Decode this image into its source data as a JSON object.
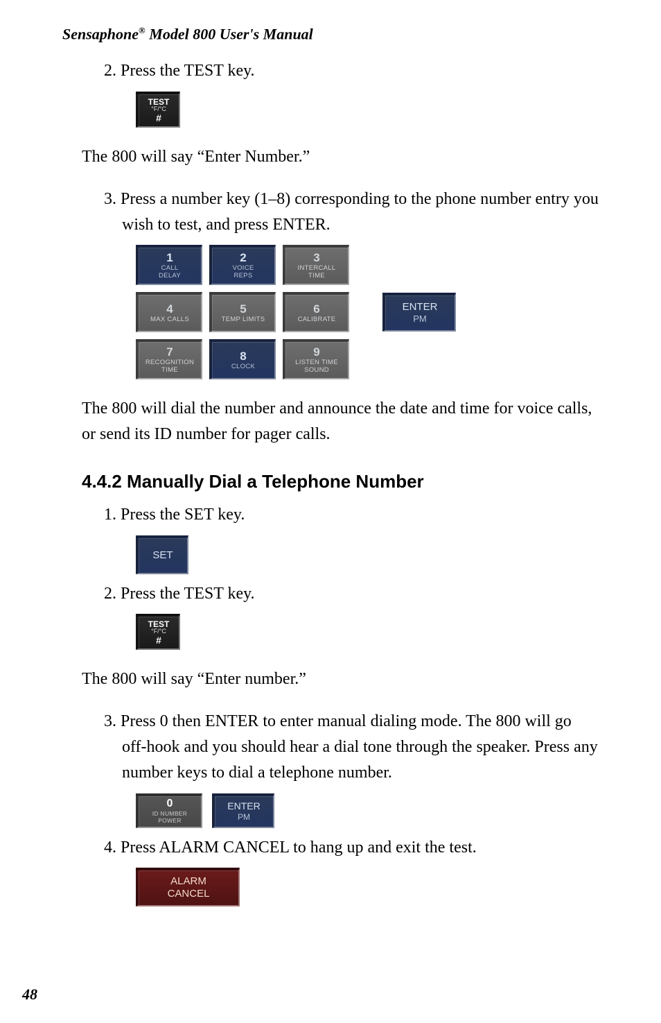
{
  "header": {
    "brand": "Sensaphone",
    "reg": "®",
    "rest": " Model 800 User's Manual"
  },
  "sec1": {
    "step2": "2. Press the TEST key.",
    "test_key": {
      "l1": "TEST",
      "l2": "°F/°C",
      "l3": "#"
    },
    "body1": "The 800 will say “Enter Number.”",
    "step3": "3. Press a number key (1–8) corresponding to the phone number entry you wish to test, and press ENTER.",
    "keypad": [
      {
        "num": "1",
        "sub1": "CALL",
        "sub2": "DELAY",
        "cls": "blue"
      },
      {
        "num": "2",
        "sub1": "VOICE",
        "sub2": "REPS",
        "cls": "blue"
      },
      {
        "num": "3",
        "sub1": "INTERCALL",
        "sub2": "TIME",
        "cls": "gray"
      },
      {
        "num": "4",
        "sub1": "MAX CALLS",
        "sub2": "",
        "cls": "gray"
      },
      {
        "num": "5",
        "sub1": "TEMP LIMITS",
        "sub2": "",
        "cls": "gray"
      },
      {
        "num": "6",
        "sub1": "CALIBRATE",
        "sub2": "",
        "cls": "gray"
      },
      {
        "num": "7",
        "sub1": "RECOGNITION",
        "sub2": "TIME",
        "cls": "gray"
      },
      {
        "num": "8",
        "sub1": "CLOCK",
        "sub2": "",
        "cls": "blue"
      },
      {
        "num": "9",
        "sub1": "LISTEN TIME",
        "sub2": "SOUND",
        "cls": "gray"
      }
    ],
    "enter": {
      "top": "ENTER",
      "bot": "PM"
    },
    "body2": "The 800 will dial the number and announce the date and time for voice calls, or send its ID number for pager calls."
  },
  "sec2": {
    "heading": "4.4.2  Manually Dial a Telephone Number",
    "step1": "1. Press the SET key.",
    "set_key": "SET",
    "step2": "2. Press the TEST key.",
    "test_key": {
      "l1": "TEST",
      "l2": "°F/°C",
      "l3": "#"
    },
    "body1": "The 800 will say “Enter number.”",
    "step3": "3. Press 0 then ENTER to enter manual dialing mode. The 800 will go off-hook and you should hear a dial tone through the speaker. Press any number keys to dial a telephone number.",
    "zero_key": {
      "num": "0",
      "sub1": "ID NUMBER",
      "sub2": "POWER"
    },
    "enter": {
      "top": "ENTER",
      "bot": "PM"
    },
    "step4": "4. Press ALARM CANCEL to hang up and exit the test.",
    "alarm_key": {
      "l1": "ALARM",
      "l2": "CANCEL"
    }
  },
  "page_num": "48"
}
